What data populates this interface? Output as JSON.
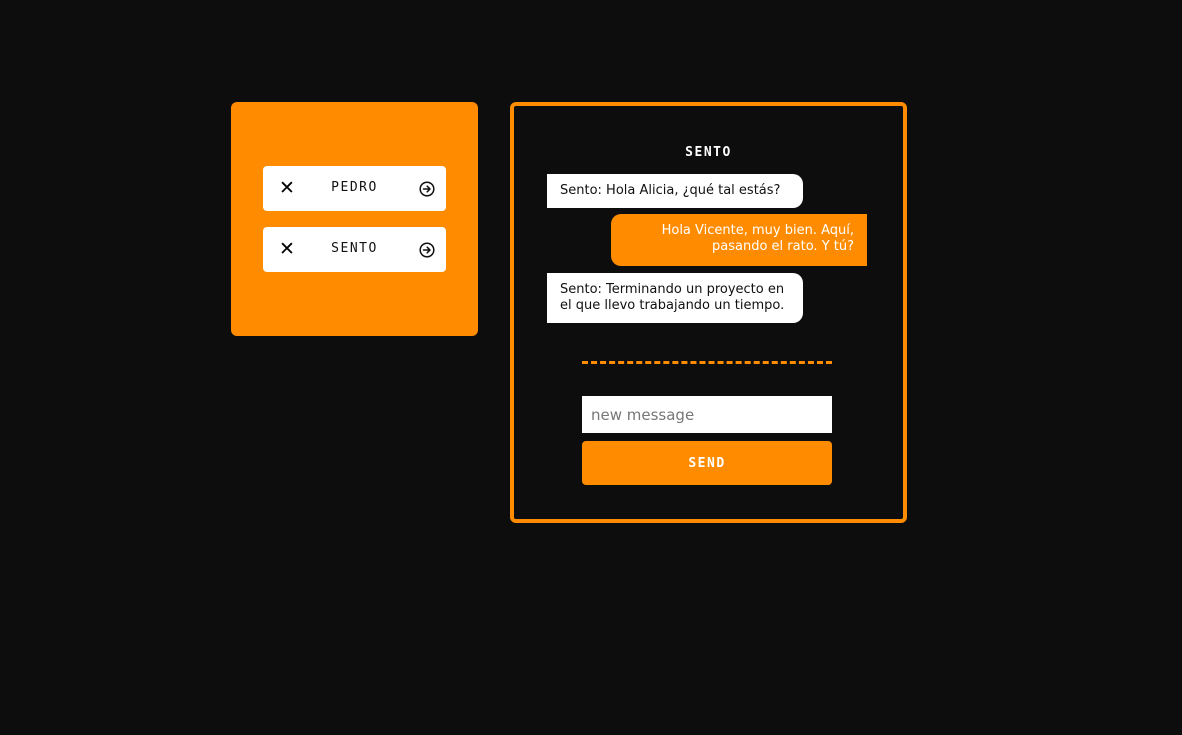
{
  "colors": {
    "background": "#0d0d0d",
    "accent": "#ff8c00",
    "card": "#ffffff"
  },
  "contacts": [
    {
      "name": "PEDRO",
      "remove_icon": "close-icon",
      "open_icon": "arrow-right-circle-icon"
    },
    {
      "name": "SENTO",
      "remove_icon": "close-icon",
      "open_icon": "arrow-right-circle-icon"
    }
  ],
  "chat": {
    "title": "SENTO",
    "messages": [
      {
        "direction": "incoming",
        "text": "Sento: Hola Alicia, ¿qué tal estás?"
      },
      {
        "direction": "outgoing",
        "text": "Hola Vicente, muy bien. Aquí, pasando el rato. Y tú?"
      },
      {
        "direction": "incoming",
        "text": "Sento: Terminando un proyecto en el que llevo trabajando un tiempo."
      }
    ],
    "input": {
      "value": "",
      "placeholder": "new message"
    },
    "send_label": "SEND"
  }
}
